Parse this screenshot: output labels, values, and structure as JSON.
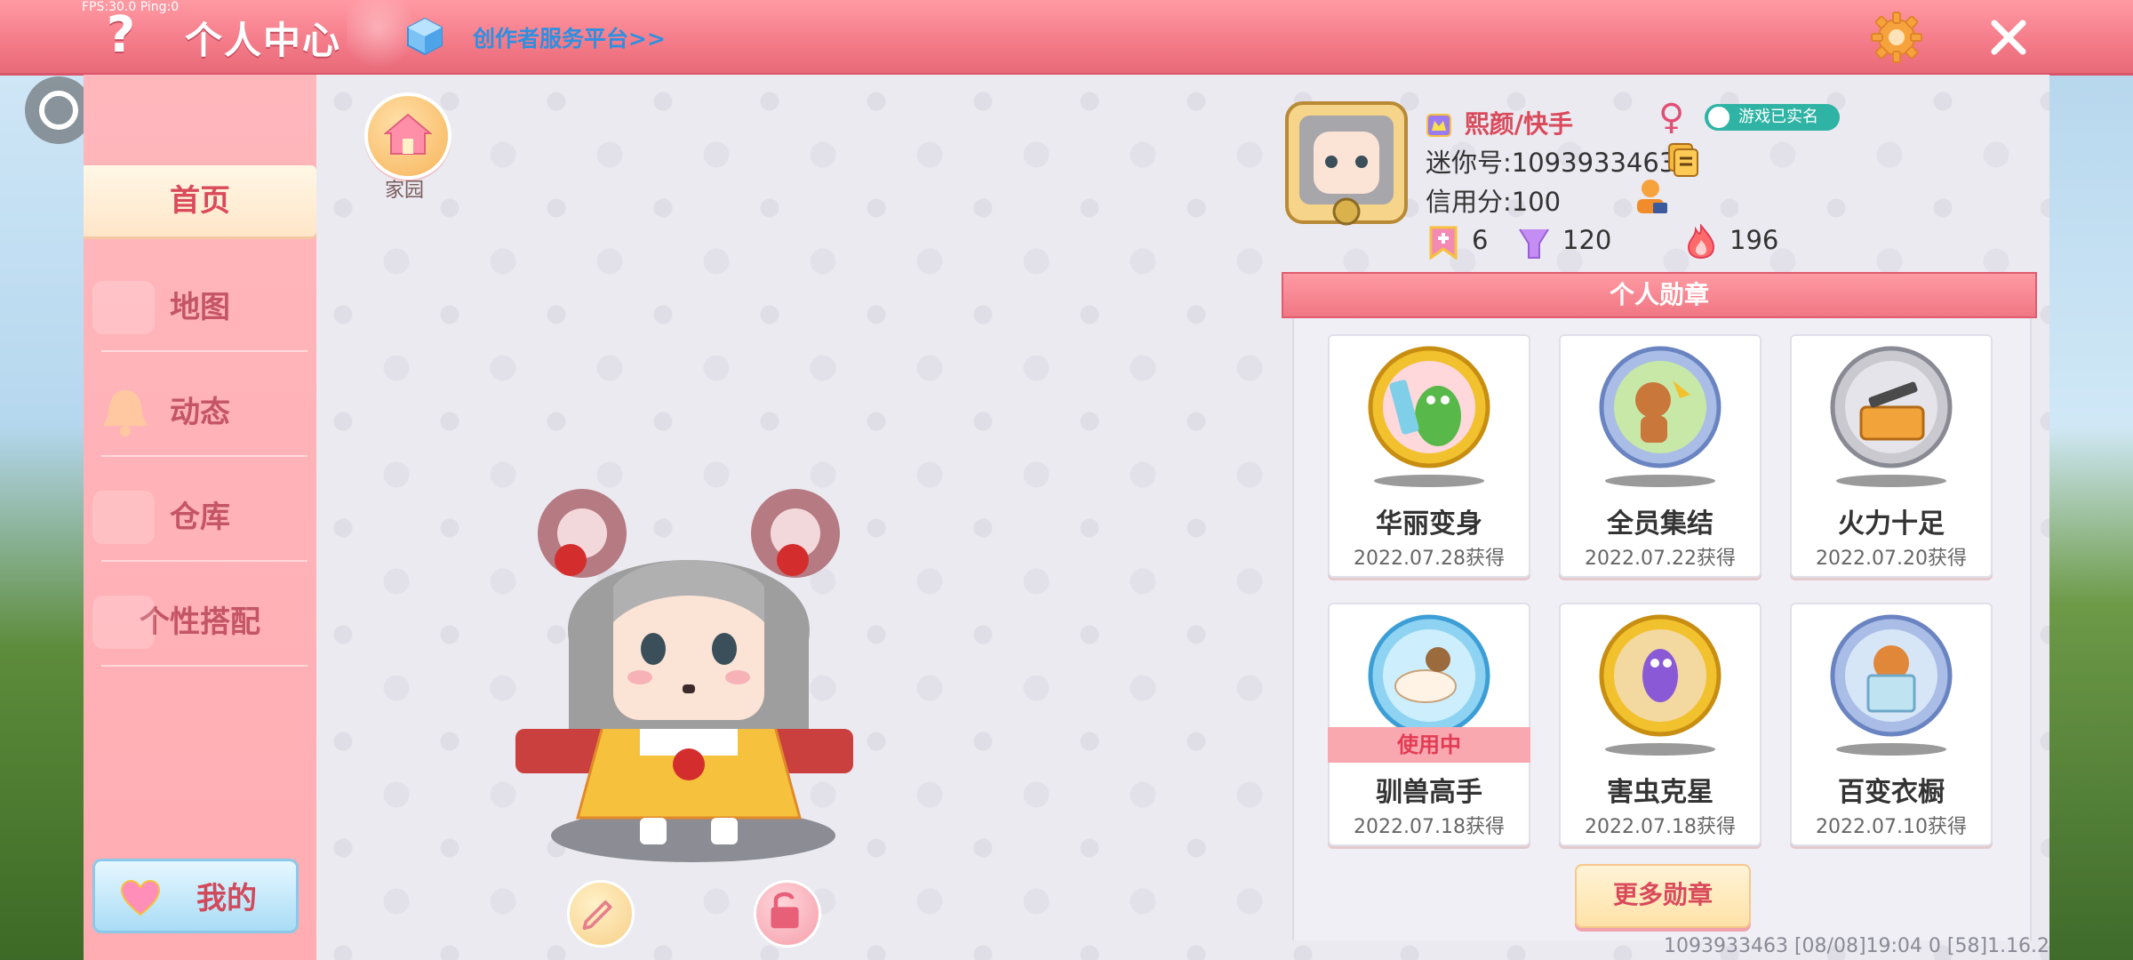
{
  "status": {
    "fps": "FPS:30.0  Ping:0"
  },
  "header": {
    "title": "个人中心",
    "creator_link": "创作者服务平台>>"
  },
  "sidebar": {
    "items": [
      {
        "label": "首页",
        "active": true
      },
      {
        "label": "地图"
      },
      {
        "label": "动态"
      },
      {
        "label": "仓库"
      },
      {
        "label": "个性搭配"
      }
    ],
    "my_button": "我的"
  },
  "main": {
    "home_label": "家园"
  },
  "profile": {
    "name": "熙颜/快手",
    "gender": "♀",
    "realname_badge": "游戏已实名",
    "mini_id": "迷你号:1093933463",
    "credit": "信用分:100",
    "stats": {
      "level": "6",
      "likes": "120",
      "heat": "196"
    }
  },
  "medals": {
    "header": "个人勋章",
    "items": [
      {
        "name": "华丽变身",
        "date": "2022.07.28获得"
      },
      {
        "name": "全员集结",
        "date": "2022.07.22获得"
      },
      {
        "name": "火力十足",
        "date": "2022.07.20获得"
      },
      {
        "name": "驯兽高手",
        "date": "2022.07.18获得",
        "status": "使用中"
      },
      {
        "name": "害虫克星",
        "date": "2022.07.18获得"
      },
      {
        "name": "百变衣橱",
        "date": "2022.07.10获得"
      }
    ],
    "more_button": "更多勋章"
  },
  "footer": {
    "info": "1093933463    [08/08]19:04 0  [58]1.16.2"
  },
  "colors": {
    "accent": "#f47a88",
    "sidebar": "#ffb7bc",
    "text_accent": "#d94a5b",
    "link": "#2f8fe0"
  }
}
